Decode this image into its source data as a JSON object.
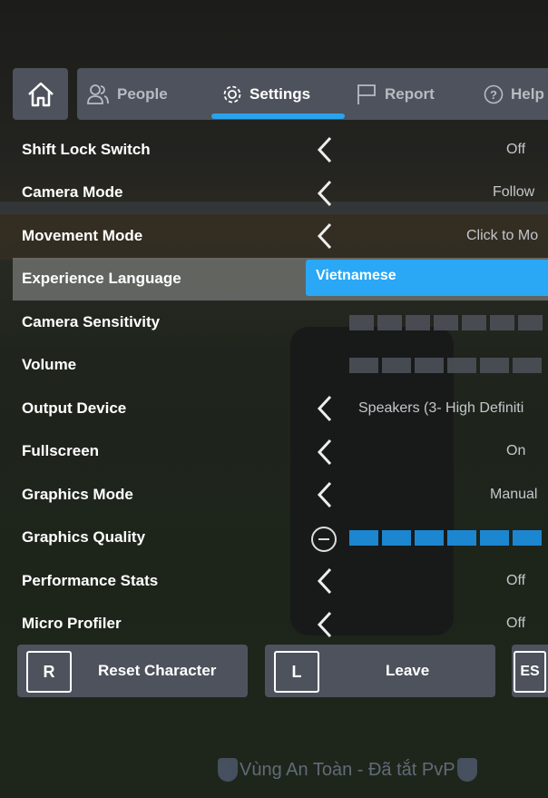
{
  "tabs": [
    {
      "label": "People",
      "icon": "people-icon"
    },
    {
      "label": "Settings",
      "icon": "gear-icon",
      "active": true
    },
    {
      "label": "Report",
      "icon": "flag-icon"
    },
    {
      "label": "Help",
      "icon": "help-icon"
    }
  ],
  "settings": [
    {
      "label": "Shift Lock Switch",
      "value": "Off"
    },
    {
      "label": "Camera Mode",
      "value": "Follow"
    },
    {
      "label": "Movement Mode",
      "value": "Click to Mo"
    },
    {
      "label": "Experience Language",
      "value": "Vietnamese"
    },
    {
      "label": "Camera Sensitivity"
    },
    {
      "label": "Volume"
    },
    {
      "label": "Output Device",
      "value": "Speakers (3- High Definiti"
    },
    {
      "label": "Fullscreen",
      "value": "On"
    },
    {
      "label": "Graphics Mode",
      "value": "Manual"
    },
    {
      "label": "Graphics Quality"
    },
    {
      "label": "Performance Stats",
      "value": "Off"
    },
    {
      "label": "Micro Profiler",
      "value": "Off"
    }
  ],
  "buttons": {
    "reset": {
      "key": "R",
      "label": "Reset Character"
    },
    "leave": {
      "key": "L",
      "label": "Leave"
    },
    "resume": {
      "key": "ES"
    }
  },
  "zone_text": "Vùng An Toàn - Đã tắt PvP",
  "colors": {
    "accent": "#2aa3ec",
    "panel": "#4d525c",
    "quality_fill": "#1d86d0"
  }
}
